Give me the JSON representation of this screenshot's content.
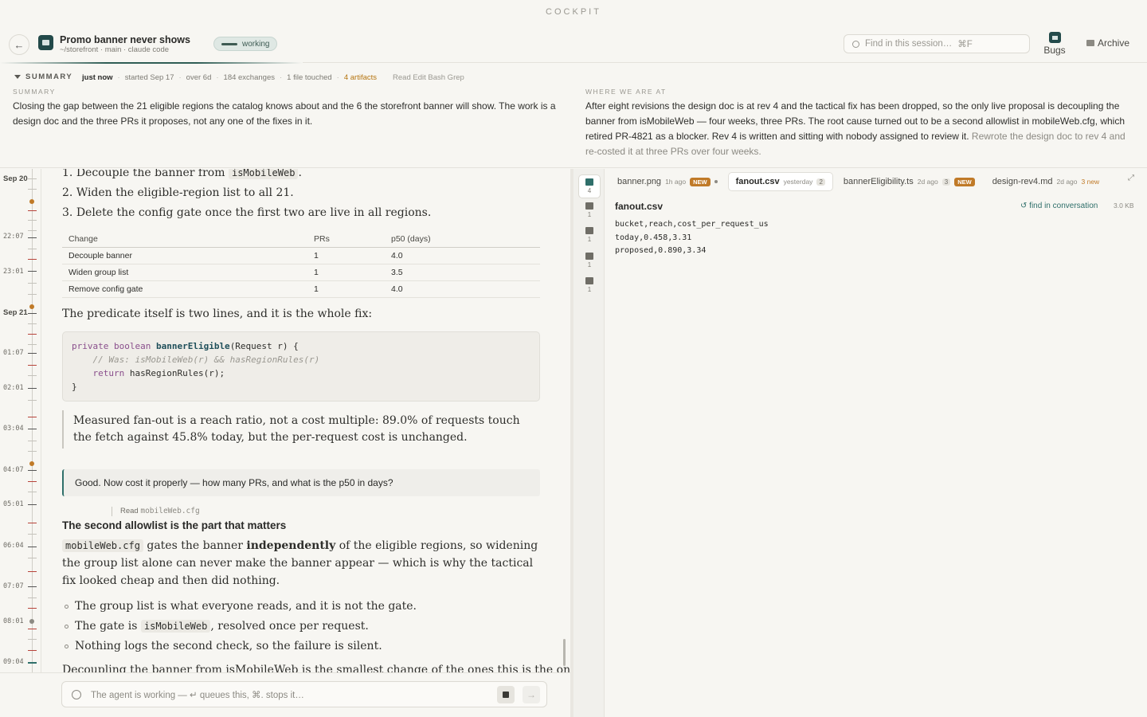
{
  "app": {
    "title": "COCKPIT"
  },
  "session": {
    "title": "Promo banner never shows",
    "subtitle": "~/storefront · main · claude code",
    "status": "working"
  },
  "search": {
    "placeholder": "Find in this session…",
    "shortcut": "⌘F"
  },
  "header_actions": {
    "bugs_label": "Bugs",
    "archive_label": "Archive"
  },
  "summary": {
    "toggle_label": "SUMMARY",
    "updated": "just now",
    "started": "started Sep 17",
    "duration": "over 6d",
    "exchanges": "184 exchanges",
    "files": "1 file touched",
    "artifacts": "4 artifacts",
    "tools": "Read Edit Bash Grep",
    "summary_header": "SUMMARY",
    "summary_text": "Closing the gap between the 21 eligible regions the catalog knows about and the 6 the storefront banner will show. The work is a design doc and the three PRs it proposes, not any one of the fixes in it.",
    "status_header": "WHERE WE ARE AT",
    "status_text": "After eight revisions the design doc is at rev 4 and the tactical fix has been dropped, so the only live proposal is decoupling the banner from isMobileWeb — four weeks, three PRs. The root cause turned out to be a second allowlist in mobileWeb.cfg, which retired PR-4821 as a blocker. Rev 4 is written and sitting with nobody assigned to review it.",
    "status_next": "Rewrote the design doc to rev 4 and re-costed it at three PRs over four weeks."
  },
  "timeline": {
    "labels": [
      "Sep 20",
      "22:07",
      "23:01",
      "Sep 21",
      "01:07",
      "02:01",
      "03:04",
      "04:07",
      "05:01",
      "06:04",
      "07:07",
      "08:01",
      "09:04"
    ]
  },
  "conversation": {
    "list": [
      {
        "num": "1.",
        "pre": "Decouple the banner from ",
        "code": "isMobileWeb",
        "post": "."
      },
      {
        "num": "2.",
        "text": "Widen the eligible-region list to all 21."
      },
      {
        "num": "3.",
        "text": "Delete the config gate once the first two are live in all regions."
      }
    ],
    "table": {
      "headers": [
        "Change",
        "PRs",
        "p50 (days)"
      ],
      "rows": [
        [
          "Decouple banner",
          "1",
          "4.0"
        ],
        [
          "Widen group list",
          "1",
          "3.5"
        ],
        [
          "Remove config gate",
          "1",
          "4.0"
        ]
      ]
    },
    "predicate_text": "The predicate itself is two lines, and it is the whole fix:",
    "code": {
      "l1_kw1": "private",
      "l1_kw2": "boolean",
      "l1_fn": "bannerEligible",
      "l1_rest": "(Request r) {",
      "l2": "    // Was: isMobileWeb(r) && hasRegionRules(r)",
      "l3_kw": "return",
      "l3_rest": " hasRegionRules(r);",
      "l4": "}"
    },
    "quote": "Measured fan-out is a reach ratio, not a cost multiple: 89.0% of requests touch the fetch against 45.8% today, but the per-request cost is unchanged.",
    "user_message": "Good. Now cost it properly — how many PRs, and what is the p50 in days?",
    "tool_use": {
      "tool": "Read",
      "target": "mobileWeb.cfg"
    },
    "heading": "The second allowlist is the part that matters",
    "para2": {
      "code": "mobileWeb.cfg",
      "pre": " gates the banner ",
      "bold": "independently",
      "post": " of the eligible regions, so widening the group list alone can never make the banner appear — which is why the tactical fix looked cheap and then did nothing."
    },
    "bullets": [
      {
        "text": "The group list is what everyone reads, and it is not the gate."
      },
      {
        "pre": "The gate is ",
        "code": "isMobileWeb",
        "post": ", resolved once per request."
      },
      {
        "text": "Nothing logs the second check, so the failure is silent."
      }
    ],
    "cut_line": "Decoupling the banner from isMobileWeb is the smallest change of the ones this is the one that"
  },
  "composer": {
    "placeholder": "The agent is working — ↵ queues this, ⌘. stops it…"
  },
  "artifacts": {
    "categories": [
      {
        "icon": "table-icon",
        "count": "4"
      },
      {
        "icon": "document-icon",
        "count": "1"
      },
      {
        "icon": "code-icon",
        "count": "1"
      },
      {
        "icon": "data-icon",
        "count": "1"
      },
      {
        "icon": "image-icon",
        "count": "1"
      }
    ],
    "tabs": [
      {
        "name": "banner.png",
        "age": "1h ago",
        "badge": "NEW"
      },
      {
        "name": "fanout.csv",
        "age": "yesterday",
        "count": "2"
      },
      {
        "name": "bannerEligibility.ts",
        "age": "2d ago",
        "count": "3",
        "badge": "NEW"
      },
      {
        "name": "design-rev4.md",
        "age": "2d ago",
        "more": "3 new"
      }
    ],
    "file": {
      "name": "fanout.csv",
      "find_label": "find in conversation",
      "size": "3.0 KB",
      "content": "bucket,reach,cost_per_request_us\ntoday,0.458,3.31\nproposed,0.890,3.34"
    }
  }
}
